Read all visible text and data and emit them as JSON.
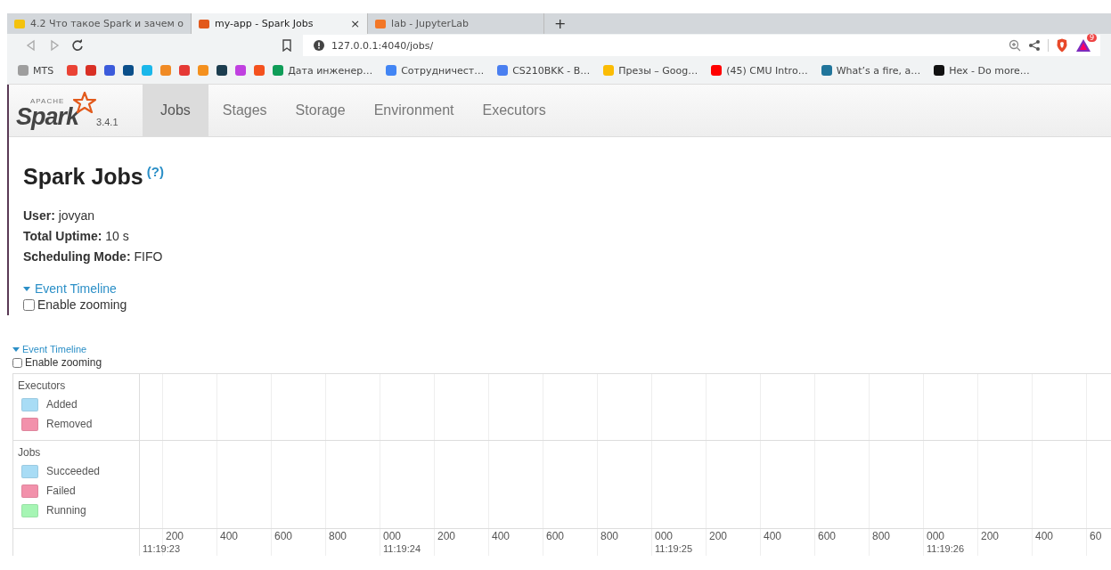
{
  "browser": {
    "tabs": [
      {
        "label": "4.2 Что такое Spark и зачем о",
        "selected": false,
        "color": "#f4c20d"
      },
      {
        "label": "my-app - Spark Jobs",
        "selected": true,
        "color": "#e25a1c",
        "close": "×"
      },
      {
        "label": "lab - JupyterLab",
        "selected": false,
        "color": "#f37726"
      }
    ],
    "new_tab": "+",
    "url": "127.0.0.1:4040/jobs/",
    "rewards_badge": "9",
    "bookmarks": [
      {
        "label": "MTS",
        "color": "#9e9e9e"
      },
      {
        "color": "#ea4335"
      },
      {
        "color": "#d93025"
      },
      {
        "color": "#3b5bdb"
      },
      {
        "color": "#0b4f8a"
      },
      {
        "color": "#1ab7ea"
      },
      {
        "color": "#f08a24"
      },
      {
        "color": "#e53935"
      },
      {
        "color": "#f4901e"
      },
      {
        "color": "#1c3d4f"
      },
      {
        "color": "#c040e0"
      },
      {
        "color": "#f4511e"
      },
      {
        "label": "Дата инженер…",
        "color": "#0f9d58"
      },
      {
        "label": "Сотрудничест…",
        "color": "#4285f4"
      },
      {
        "label": "CS210BKK - B…",
        "color": "#4a7ff0"
      },
      {
        "label": "Презы – Goog…",
        "color": "#fbbc04"
      },
      {
        "label": "(45) CMU Intro…",
        "color": "#ff0000"
      },
      {
        "label": "What’s a fire, a…",
        "color": "#21759b"
      },
      {
        "label": "Hex - Do more…",
        "color": "#111111"
      }
    ]
  },
  "app": {
    "logo_top": "APACHE",
    "logo": "Spark",
    "version": "3.4.1",
    "nav": [
      {
        "label": "Jobs",
        "selected": true
      },
      {
        "label": "Stages",
        "selected": false
      },
      {
        "label": "Storage",
        "selected": false
      },
      {
        "label": "Environment",
        "selected": false
      },
      {
        "label": "Executors",
        "selected": false
      }
    ]
  },
  "page": {
    "title": "Spark Jobs",
    "help": "(?)",
    "info": [
      {
        "key": "User:",
        "value": "jovyan"
      },
      {
        "key": "Total Uptime:",
        "value": "10 s"
      },
      {
        "key": "Scheduling Mode:",
        "value": "FIFO"
      }
    ],
    "timeline_toggle": {
      "label": "Event Timeline",
      "expanded": true
    },
    "zoom_checkbox": {
      "label": "Enable zooming",
      "checked": false
    }
  },
  "timeline_preview": {
    "timeline_toggle": {
      "label": "Event Timeline",
      "expanded": true
    },
    "zoom_checkbox": {
      "label": "Enable zooming",
      "checked": false
    },
    "groups": [
      {
        "title": "Executors",
        "items": [
          {
            "label": "Added",
            "color": "#a8dcf5"
          },
          {
            "label": "Removed",
            "color": "#f291ab"
          }
        ]
      },
      {
        "title": "Jobs",
        "items": [
          {
            "label": "Succeeded",
            "color": "#a8dcf5"
          },
          {
            "label": "Failed",
            "color": "#f291ab"
          },
          {
            "label": "Running",
            "color": "#a6f5b4"
          }
        ]
      }
    ],
    "axis": {
      "start_time": "11:19:23",
      "ticks": [
        {
          "label": "200"
        },
        {
          "label": "400"
        },
        {
          "label": "600"
        },
        {
          "label": "800"
        },
        {
          "label": "000",
          "time": "11:19:24"
        },
        {
          "label": "200"
        },
        {
          "label": "400"
        },
        {
          "label": "600"
        },
        {
          "label": "800"
        },
        {
          "label": "000",
          "time": "11:19:25"
        },
        {
          "label": "200"
        },
        {
          "label": "400"
        },
        {
          "label": "600"
        },
        {
          "label": "800"
        },
        {
          "label": "000",
          "time": "11:19:26"
        },
        {
          "label": "200"
        },
        {
          "label": "400"
        },
        {
          "label": "60"
        }
      ]
    }
  }
}
